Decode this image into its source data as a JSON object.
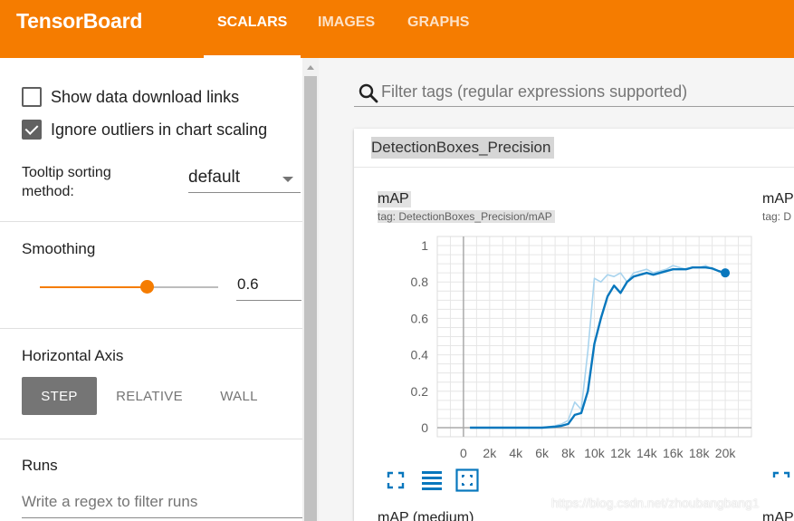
{
  "app": {
    "brand": "TensorBoard",
    "tabs": [
      {
        "label": "SCALARS",
        "active": true
      },
      {
        "label": "IMAGES",
        "active": false
      },
      {
        "label": "GRAPHS",
        "active": false
      }
    ],
    "accent_color": "#f57c00"
  },
  "sidebar": {
    "show_download_label": "Show data download links",
    "show_download_checked": false,
    "ignore_outliers_label": "Ignore outliers in chart scaling",
    "ignore_outliers_checked": true,
    "tooltip_label": "Tooltip sorting method:",
    "tooltip_value": "default",
    "smoothing_title": "Smoothing",
    "smoothing_value": "0.6",
    "smoothing_level": 0.6,
    "axis_title": "Horizontal Axis",
    "axis_buttons": [
      {
        "label": "STEP",
        "active": true
      },
      {
        "label": "RELATIVE",
        "active": false
      },
      {
        "label": "WALL",
        "active": false
      }
    ],
    "runs_title": "Runs",
    "runs_placeholder": "Write a regex to filter runs"
  },
  "main": {
    "filter_placeholder": "Filter tags (regular expressions supported)",
    "card_title": "DetectionBoxes_Precision",
    "chart": {
      "title": "mAP",
      "tag": "tag: DetectionBoxes_Precision/mAP"
    },
    "chart2": {
      "title": "mAP",
      "tag": "tag: D"
    },
    "bottom_titles": [
      "mAP (medium)",
      "mAP"
    ],
    "watermark": "https://blog.csdn.net/zhoubangbang1"
  },
  "chart_data": {
    "type": "line",
    "title": "mAP",
    "xlabel": "",
    "ylabel": "",
    "xlim": [
      -2000,
      22000
    ],
    "ylim": [
      -0.05,
      1.05
    ],
    "x_ticks": [
      "0",
      "2k",
      "4k",
      "6k",
      "8k",
      "10k",
      "12k",
      "14k",
      "16k",
      "18k",
      "20k"
    ],
    "x_tick_values": [
      0,
      2000,
      4000,
      6000,
      8000,
      10000,
      12000,
      14000,
      16000,
      18000,
      20000
    ],
    "y_ticks": [
      "0",
      "0.2",
      "0.4",
      "0.6",
      "0.8",
      "1"
    ],
    "y_tick_values": [
      0,
      0.2,
      0.4,
      0.6,
      0.8,
      1.0
    ],
    "grid": true,
    "series": [
      {
        "role": "raw",
        "color": "#a9d4ee",
        "x": [
          500,
          2000,
          4000,
          6000,
          7000,
          7500,
          8000,
          8500,
          9000,
          9500,
          10000,
          10500,
          11000,
          11500,
          12000,
          12500,
          13000,
          13500,
          14000,
          14500,
          15000,
          15500,
          16000,
          16500,
          17000,
          17500,
          18000,
          18500,
          19000,
          19500,
          20000
        ],
        "y": [
          0.0,
          0.0,
          0.0,
          0.0,
          0.01,
          0.02,
          0.04,
          0.14,
          0.1,
          0.42,
          0.82,
          0.8,
          0.84,
          0.83,
          0.85,
          0.8,
          0.85,
          0.86,
          0.87,
          0.85,
          0.86,
          0.87,
          0.89,
          0.88,
          0.87,
          0.88,
          0.88,
          0.89,
          0.87,
          0.86,
          0.85
        ]
      },
      {
        "role": "smoothed",
        "color": "#0877bd",
        "x": [
          500,
          2000,
          4000,
          6000,
          7000,
          7500,
          8000,
          8500,
          9000,
          9500,
          10000,
          10500,
          11000,
          11500,
          12000,
          12500,
          13000,
          13500,
          14000,
          14500,
          15000,
          15500,
          16000,
          16500,
          17000,
          17500,
          18000,
          18500,
          19000,
          19500,
          20000
        ],
        "y": [
          0.0,
          0.0,
          0.0,
          0.0,
          0.005,
          0.01,
          0.02,
          0.07,
          0.08,
          0.2,
          0.46,
          0.6,
          0.72,
          0.78,
          0.74,
          0.8,
          0.83,
          0.84,
          0.85,
          0.84,
          0.85,
          0.86,
          0.87,
          0.87,
          0.87,
          0.88,
          0.88,
          0.88,
          0.875,
          0.86,
          0.85
        ]
      }
    ]
  }
}
